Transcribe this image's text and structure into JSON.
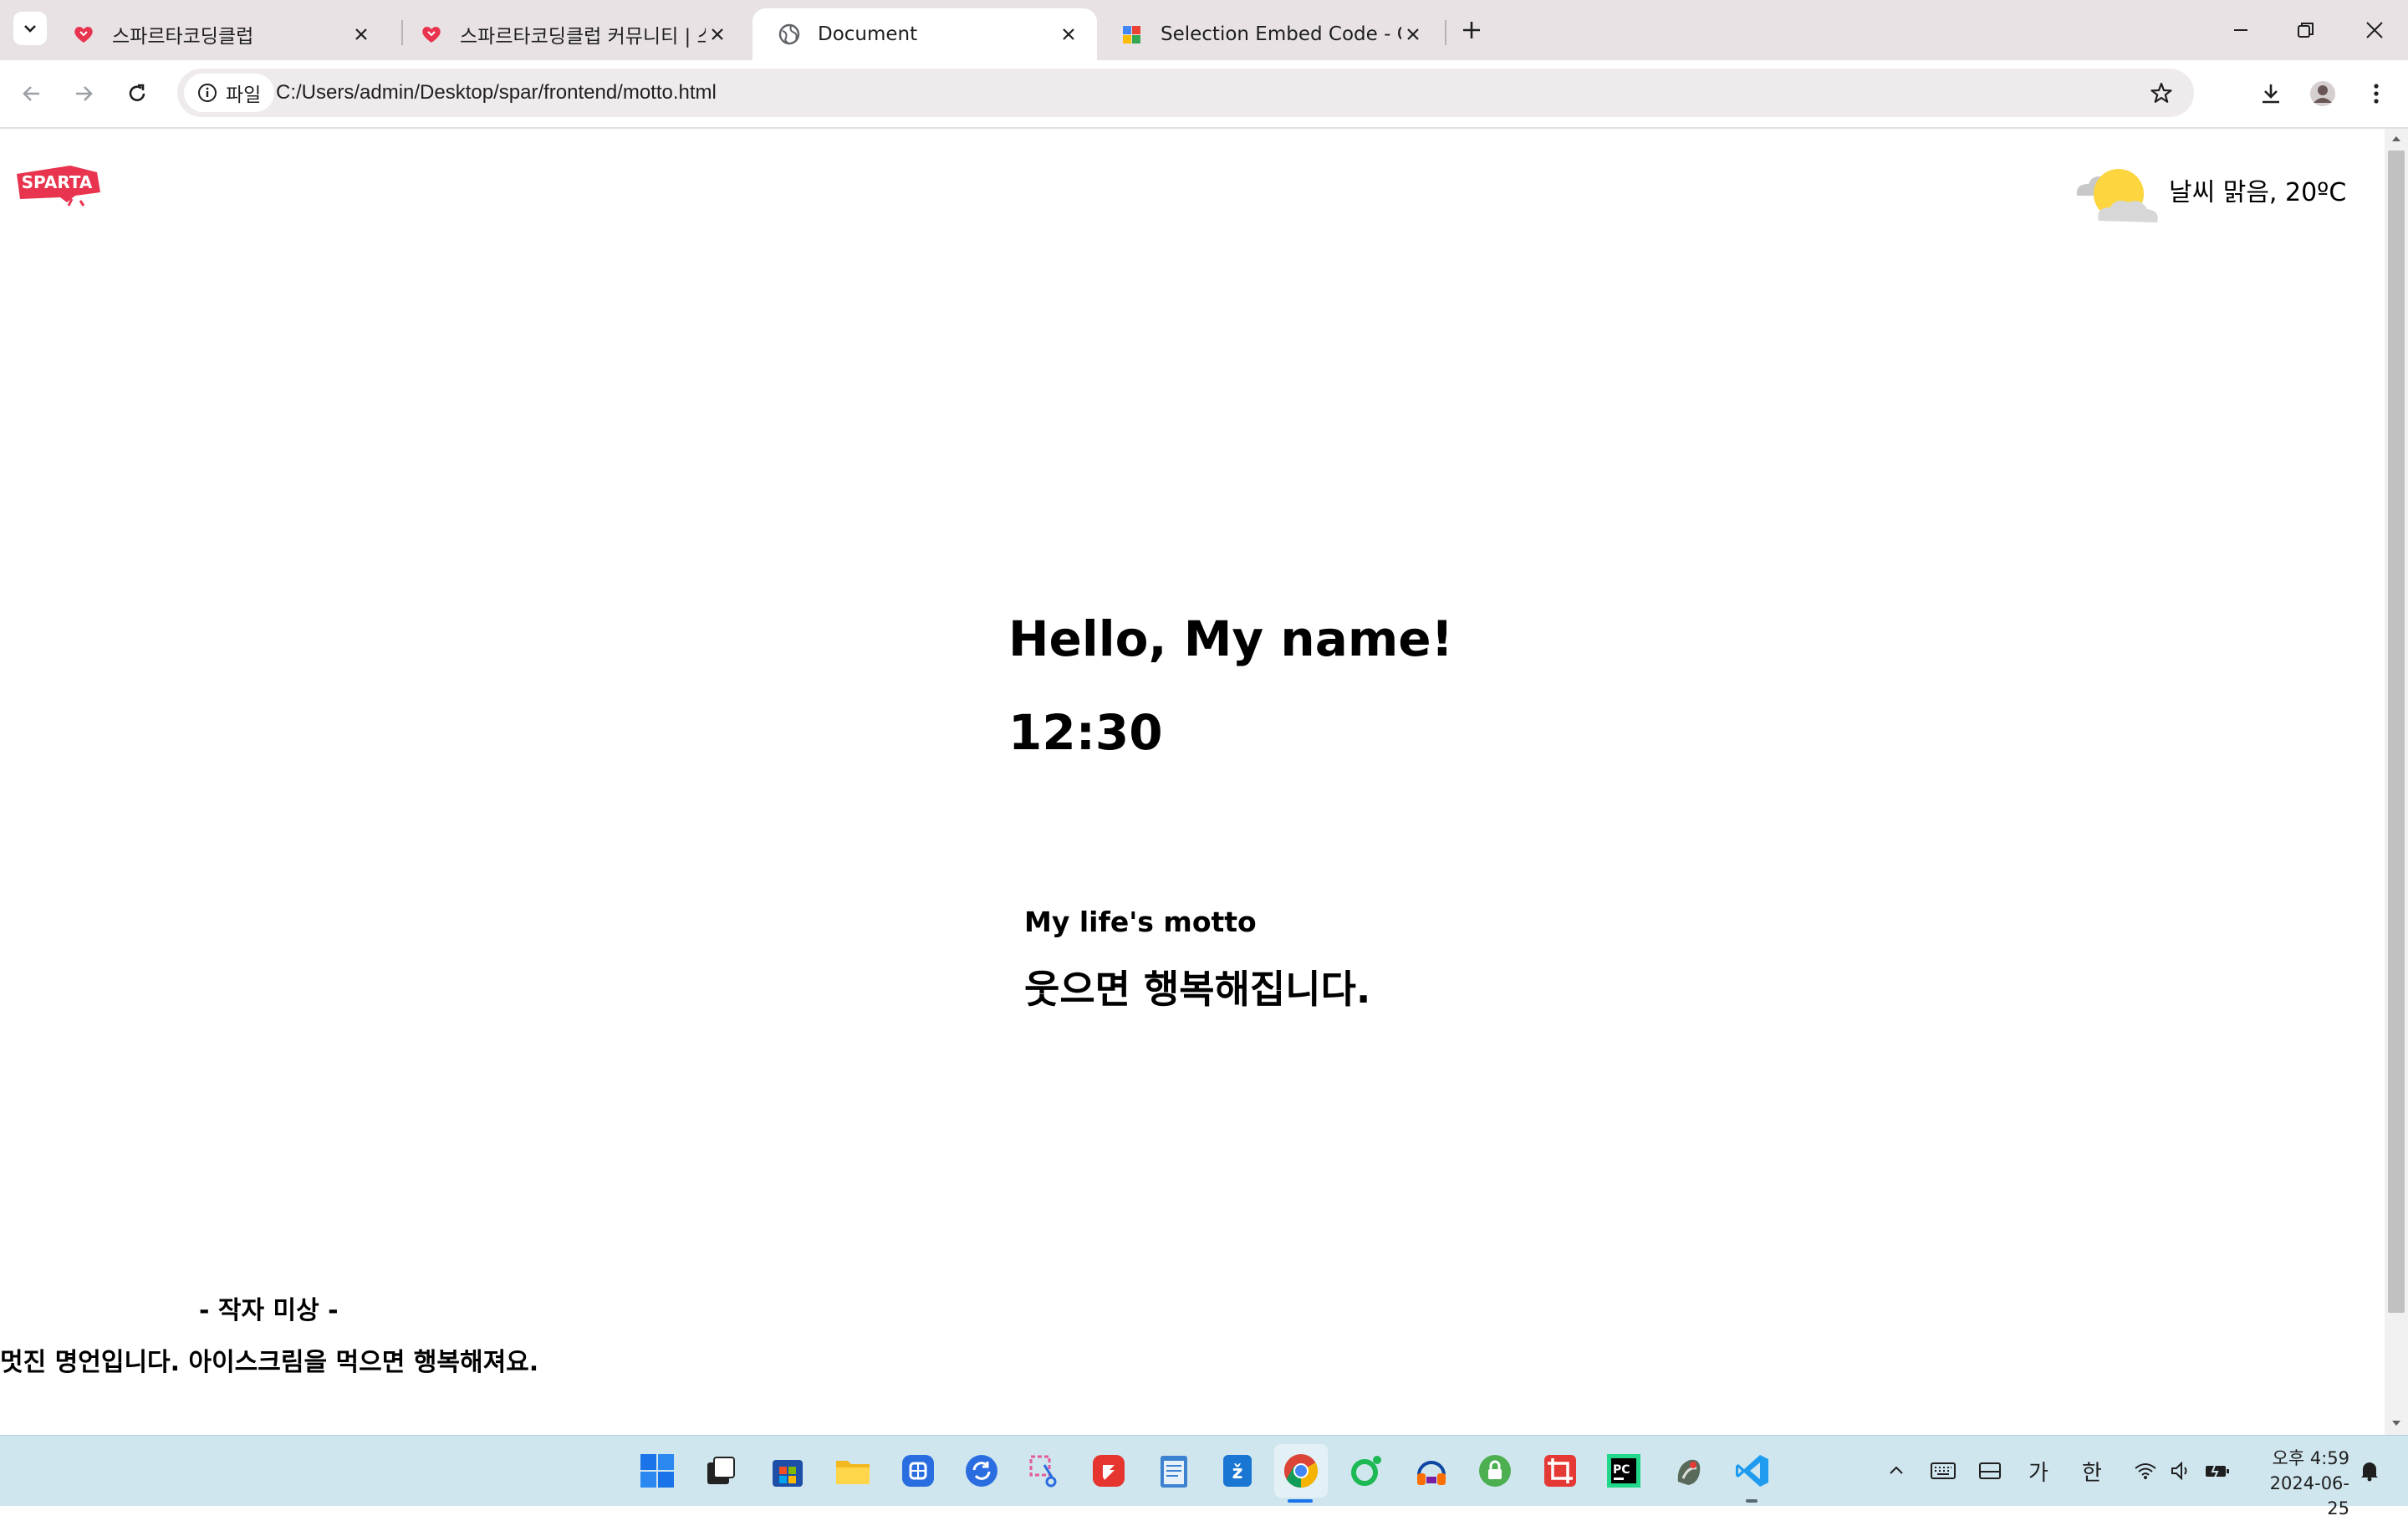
{
  "browser": {
    "tabs": [
      {
        "title": "스파르타코딩클럽",
        "favicon": "sparta-heart-icon",
        "active": false
      },
      {
        "title": "스파르타코딩클럽 커뮤니티 | 스",
        "favicon": "sparta-heart-icon",
        "active": false
      },
      {
        "title": "Document",
        "favicon": "globe-icon",
        "active": true
      },
      {
        "title": "Selection Embed Code - Goo",
        "favicon": "puzzle-icon",
        "active": false
      }
    ],
    "omnibox": {
      "scheme_chip": "파일",
      "url": "C:/Users/admin/Desktop/spar/frontend/motto.html"
    }
  },
  "page": {
    "logo_text": "SPARTA",
    "weather": {
      "icon": "partly-cloudy-icon",
      "text": "날씨 맑음, 20ºC"
    },
    "greeting": "Hello, My name!",
    "time": "12:30",
    "motto_label": "My life's motto",
    "motto": "웃으면 행복해집니다.",
    "author": "- 작자 미상 -",
    "comment": "멋진 명언입니다. 아이스크림을 먹으면 행복해져요."
  },
  "taskbar": {
    "apps": [
      "start",
      "task-view",
      "store",
      "file-explorer",
      "app-blue-square",
      "sync-app",
      "snipping-tool",
      "red-app",
      "notepad",
      "translate-app",
      "chrome",
      "green-app",
      "headphones-app",
      "green-lock-app",
      "crop-app",
      "pycharm",
      "tortoise-app",
      "vscode"
    ],
    "ime_mode": "가",
    "ime_lang": "한",
    "time": "오후 4:59",
    "date": "2024-06-25",
    "colors": {
      "taskbar_bg": "#cfe6ee",
      "accent": "#1a73e8"
    }
  }
}
